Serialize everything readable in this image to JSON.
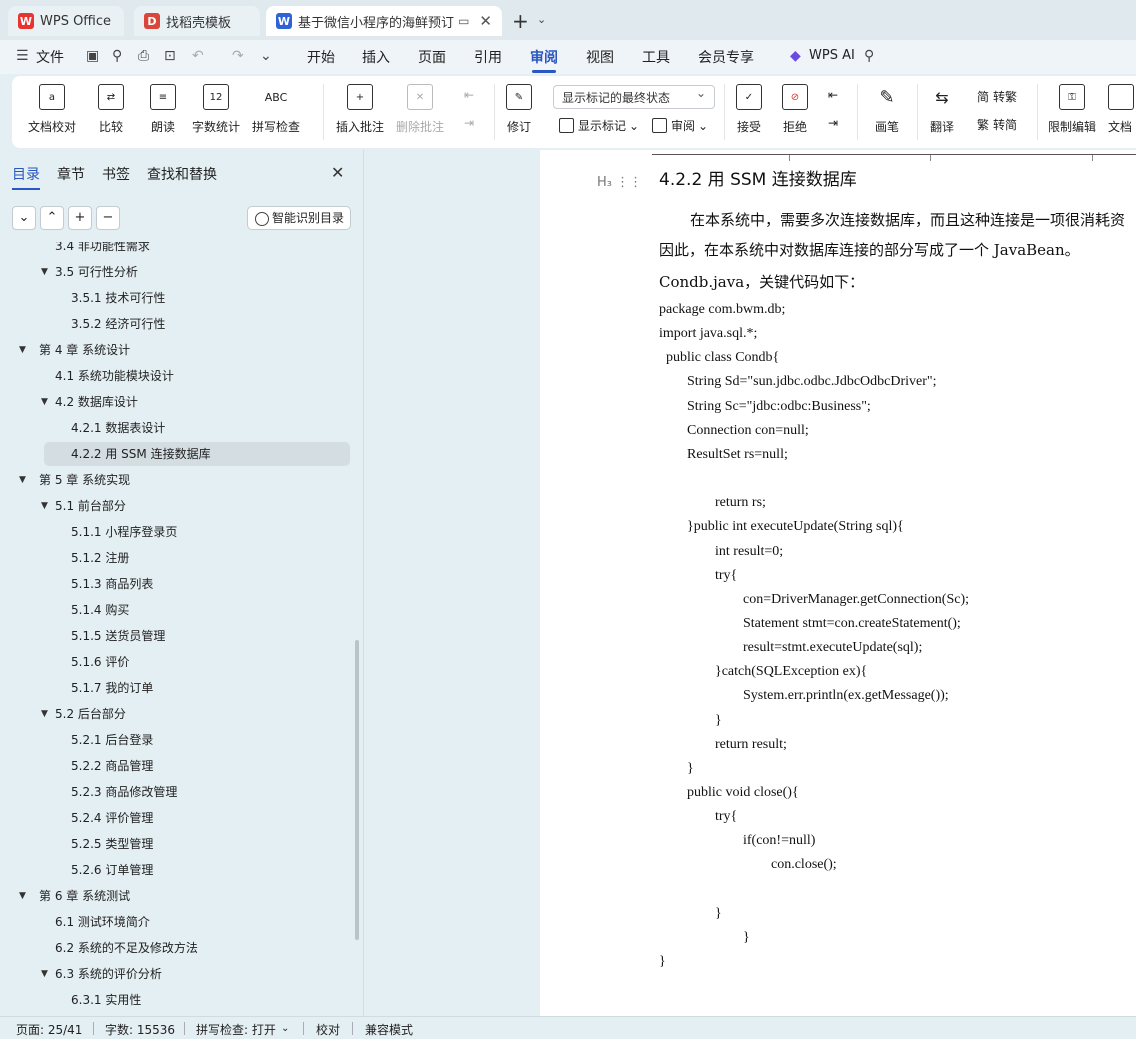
{
  "tabs": [
    {
      "label": "WPS Office",
      "logo": "W"
    },
    {
      "label": "找稻壳模板",
      "logo": "D"
    },
    {
      "label": "基于微信小程序的海鲜预订系统",
      "logo": "W"
    }
  ],
  "menu": {
    "file": "文件",
    "items": [
      "开始",
      "插入",
      "页面",
      "引用",
      "审阅",
      "视图",
      "工具",
      "会员专享"
    ],
    "active": "审阅",
    "ai": "WPS AI"
  },
  "ribbon": {
    "proof": "文档校对",
    "compare": "比较",
    "read": "朗读",
    "wordcount": "字数统计",
    "wordcount_glyph": "12",
    "spell": "拼写检查",
    "spell_glyph": "ABC",
    "insert_comment": "插入批注",
    "delete_comment": "删除批注",
    "revise": "修订",
    "mark_state": "显示标记的最终状态",
    "show_marks": "显示标记",
    "review": "审阅",
    "accept": "接受",
    "reject": "拒绝",
    "pen": "画笔",
    "translate": "翻译",
    "to_trad": "转繁",
    "to_simp": "转简",
    "to_trad_glyph": "简",
    "to_simp_glyph": "繁",
    "restrict": "限制编辑",
    "doc_more": "文档"
  },
  "nav": {
    "tabs": [
      "目录",
      "章节",
      "书签",
      "查找和替换"
    ],
    "smart_btn": "智能识别目录",
    "controls": [
      "⌄",
      "⌃",
      "+",
      "−"
    ],
    "toc": [
      {
        "label": "3.4 非功能性需求",
        "level": 2
      },
      {
        "label": "3.5  可行性分析",
        "level": 2,
        "expanded": true
      },
      {
        "label": "3.5.1  技术可行性",
        "level": 3
      },
      {
        "label": "3.5.2  经济可行性",
        "level": 3
      },
      {
        "label": "第 4 章  系统设计",
        "level": 1,
        "expanded": true
      },
      {
        "label": "4.1 系统功能模块设计",
        "level": 2
      },
      {
        "label": "4.2 数据库设计",
        "level": 2,
        "expanded": true
      },
      {
        "label": "4.2.1 数据表设计",
        "level": 3
      },
      {
        "label": "4.2.2 用 SSM 连接数据库",
        "level": 3,
        "selected": true
      },
      {
        "label": "第 5 章  系统实现",
        "level": 1,
        "expanded": true
      },
      {
        "label": "5.1  前台部分",
        "level": 2,
        "expanded": true
      },
      {
        "label": "5.1.1  小程序登录页",
        "level": 3
      },
      {
        "label": "5.1.2  注册",
        "level": 3
      },
      {
        "label": "5.1.3  商品列表",
        "level": 3
      },
      {
        "label": "5.1.4  购买",
        "level": 3
      },
      {
        "label": "5.1.5  送货员管理",
        "level": 3
      },
      {
        "label": "5.1.6  评价",
        "level": 3
      },
      {
        "label": "5.1.7  我的订单",
        "level": 3
      },
      {
        "label": "5.2  后台部分",
        "level": 2,
        "expanded": true
      },
      {
        "label": "5.2.1  后台登录",
        "level": 3
      },
      {
        "label": "5.2.2  商品管理",
        "level": 3
      },
      {
        "label": "5.2.3  商品修改管理",
        "level": 3
      },
      {
        "label": "5.2.4  评价管理",
        "level": 3
      },
      {
        "label": "5.2.5  类型管理",
        "level": 3
      },
      {
        "label": "5.2.6  订单管理",
        "level": 3
      },
      {
        "label": "第 6 章  系统测试",
        "level": 1,
        "expanded": true
      },
      {
        "label": "6.1  测试环境简介",
        "level": 2
      },
      {
        "label": "6.2  系统的不足及修改方法",
        "level": 2
      },
      {
        "label": "6.3  系统的评价分析",
        "level": 2,
        "expanded": true
      },
      {
        "label": "6.3.1  实用性",
        "level": 3
      }
    ]
  },
  "document": {
    "heading_marker": "H₃",
    "heading": "4.2.2 用 SSM 连接数据库",
    "paragraph": [
      "在本系统中，需要多次连接数据库，而且这种连接是一项很消耗资",
      "因此，在本系统中对数据库连接的部分写成了一个 JavaBean。",
      "Condb.java，关键代码如下："
    ],
    "code": [
      {
        "text": "package com.bwm.db;",
        "indent": 0
      },
      {
        "text": "import java.sql.*;",
        "indent": 0
      },
      {
        "text": "public class Condb{",
        "indent": 0.25
      },
      {
        "text": "String Sd=\"sun.jdbc.odbc.JdbcOdbcDriver\";",
        "indent": 1
      },
      {
        "text": "String Sc=\"jdbc:odbc:Business\";",
        "indent": 1
      },
      {
        "text": "Connection con=null;",
        "indent": 1
      },
      {
        "text": "ResultSet rs=null;",
        "indent": 1
      },
      {
        "text": "",
        "indent": 0
      },
      {
        "text": "return rs;",
        "indent": 2
      },
      {
        "text": "}public int executeUpdate(String sql){",
        "indent": 1
      },
      {
        "text": "int result=0;",
        "indent": 2
      },
      {
        "text": "try{",
        "indent": 2
      },
      {
        "text": "con=DriverManager.getConnection(Sc);",
        "indent": 3
      },
      {
        "text": "Statement stmt=con.createStatement();",
        "indent": 3
      },
      {
        "text": "result=stmt.executeUpdate(sql);",
        "indent": 3
      },
      {
        "text": "}catch(SQLException ex){",
        "indent": 2
      },
      {
        "text": "System.err.println(ex.getMessage());",
        "indent": 3
      },
      {
        "text": "}",
        "indent": 2
      },
      {
        "text": "return result;",
        "indent": 2
      },
      {
        "text": "}",
        "indent": 1
      },
      {
        "text": "public void close(){",
        "indent": 1
      },
      {
        "text": "try{",
        "indent": 2
      },
      {
        "text": "if(con!=null)",
        "indent": 3
      },
      {
        "text": "con.close();",
        "indent": 4
      },
      {
        "text": "",
        "indent": 0
      },
      {
        "text": "}",
        "indent": 2
      },
      {
        "text": "}",
        "indent": 3
      },
      {
        "text": "}",
        "indent": 0
      }
    ]
  },
  "status": {
    "page": "页面: 25/41",
    "words": "字数: 15536",
    "spell": "拼写检查: 打开",
    "proof": "校对",
    "mode": "兼容模式"
  },
  "colors": {
    "accent": "#2b57c2",
    "wps_red": "#e8342f",
    "docer_red": "#d9463b",
    "writer_blue": "#2f62d6"
  }
}
